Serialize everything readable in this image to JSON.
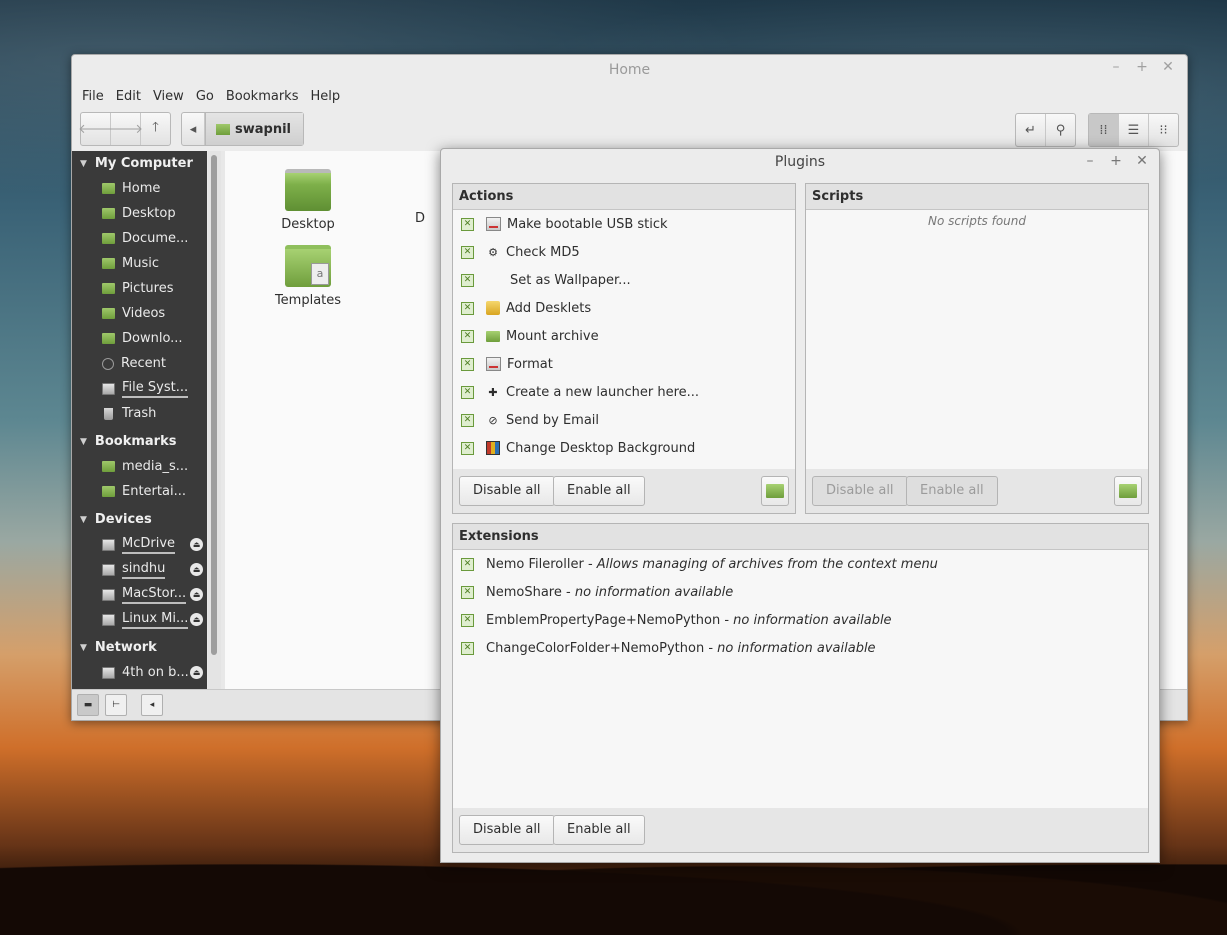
{
  "nemo": {
    "title": "Home",
    "menu": [
      "File",
      "Edit",
      "View",
      "Go",
      "Bookmarks",
      "Help"
    ],
    "path_label": "swapnil",
    "sidebar": {
      "sections": [
        {
          "title": "My Computer",
          "items": [
            {
              "label": "Home",
              "icon": "home-folder-icon"
            },
            {
              "label": "Desktop",
              "icon": "desktop-icon"
            },
            {
              "label": "Docume...",
              "icon": "folder-icon"
            },
            {
              "label": "Music",
              "icon": "folder-icon"
            },
            {
              "label": "Pictures",
              "icon": "folder-icon"
            },
            {
              "label": "Videos",
              "icon": "folder-icon"
            },
            {
              "label": "Downlo...",
              "icon": "folder-icon"
            },
            {
              "label": "Recent",
              "icon": "recent-icon"
            },
            {
              "label": "File Syst...",
              "icon": "drive-icon"
            },
            {
              "label": "Trash",
              "icon": "trash-icon"
            }
          ]
        },
        {
          "title": "Bookmarks",
          "items": [
            {
              "label": "media_s...",
              "icon": "folder-icon"
            },
            {
              "label": "Entertai...",
              "icon": "folder-icon"
            }
          ]
        },
        {
          "title": "Devices",
          "items": [
            {
              "label": "McDrive",
              "icon": "drive-icon"
            },
            {
              "label": "sindhu",
              "icon": "drive-icon"
            },
            {
              "label": "MacStor...",
              "icon": "drive-icon"
            },
            {
              "label": "Linux Mi...",
              "icon": "drive-icon"
            }
          ]
        },
        {
          "title": "Network",
          "items": [
            {
              "label": "4th on b...",
              "icon": "drive-icon"
            }
          ]
        }
      ]
    },
    "content_items": [
      {
        "label": "Desktop"
      },
      {
        "label": "Templates"
      },
      {
        "label": "D"
      }
    ]
  },
  "plugins": {
    "title": "Plugins",
    "actions": {
      "header": "Actions",
      "items": [
        {
          "label": "Make bootable USB stick",
          "icon": "usb-icon"
        },
        {
          "label": "Check MD5",
          "icon": "gear-icon"
        },
        {
          "label": "Set as Wallpaper...",
          "icon": "none"
        },
        {
          "label": "Add Desklets",
          "icon": "desklet-icon"
        },
        {
          "label": "Mount archive",
          "icon": "folder-icon"
        },
        {
          "label": "Format",
          "icon": "usb-icon"
        },
        {
          "label": "Create a new launcher here...",
          "icon": "plus-icon"
        },
        {
          "label": "Send by Email",
          "icon": "attachment-icon"
        },
        {
          "label": "Change Desktop Background",
          "icon": "background-icon"
        }
      ],
      "disable_all": "Disable all",
      "enable_all": "Enable all"
    },
    "scripts": {
      "header": "Scripts",
      "empty_text": "No scripts found",
      "disable_all": "Disable all",
      "enable_all": "Enable all"
    },
    "extensions": {
      "header": "Extensions",
      "items": [
        {
          "name": "Nemo Fileroller",
          "desc": "Allows managing of archives from the context menu"
        },
        {
          "name": "NemoShare",
          "desc": "no information available"
        },
        {
          "name": "EmblemPropertyPage+NemoPython",
          "desc": "no information available"
        },
        {
          "name": "ChangeColorFolder+NemoPython",
          "desc": "no information available"
        }
      ],
      "separator": " - ",
      "disable_all": "Disable all",
      "enable_all": "Enable all"
    }
  }
}
